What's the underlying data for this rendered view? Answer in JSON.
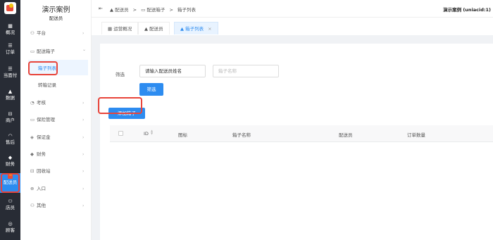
{
  "rail": {
    "items": [
      {
        "label": "概况",
        "icon": "dashboard-icon",
        "glyph": "▦"
      },
      {
        "label": "订单",
        "icon": "orders-icon",
        "glyph": "☰"
      },
      {
        "label": "当面付",
        "icon": "pay-icon",
        "glyph": "☰"
      },
      {
        "label": "数据",
        "icon": "data-icon",
        "glyph": "▲"
      },
      {
        "label": "商户",
        "icon": "merchant-icon",
        "glyph": "⊟"
      },
      {
        "label": "售后",
        "icon": "aftersale-icon",
        "glyph": "◠"
      },
      {
        "label": "财务",
        "icon": "finance-icon",
        "glyph": "◆"
      },
      {
        "label": "配送员",
        "icon": "courier-icon",
        "glyph": ""
      },
      {
        "label": "店员",
        "icon": "staff-icon",
        "glyph": "⚇"
      },
      {
        "label": "顾客",
        "icon": "customer-icon",
        "glyph": "◎"
      }
    ]
  },
  "sidebar": {
    "title": "演示案例",
    "subtitle": "配送员",
    "items": [
      {
        "label": "平台",
        "glyph": "⚇",
        "arrow": "›"
      },
      {
        "label": "配送箱子",
        "glyph": "▭",
        "arrow": "⌄"
      },
      {
        "label": "箱子列表",
        "glyph": "",
        "arrow": ""
      },
      {
        "label": "转箱记录",
        "glyph": "",
        "arrow": ""
      },
      {
        "label": "考核",
        "glyph": "◔",
        "arrow": "›"
      },
      {
        "label": "保险管理",
        "glyph": "▭",
        "arrow": "›"
      },
      {
        "label": "保证金",
        "glyph": "◈",
        "arrow": "›"
      },
      {
        "label": "财务",
        "glyph": "◆",
        "arrow": "›"
      },
      {
        "label": "回收站",
        "glyph": "⊡",
        "arrow": "›"
      },
      {
        "label": "入口",
        "glyph": "⊕",
        "arrow": "›"
      },
      {
        "label": "其他",
        "glyph": "⚇",
        "arrow": "›"
      }
    ]
  },
  "header": {
    "collapse_glyph": "⇤",
    "crumb1": "配送员",
    "sep": ">",
    "crumb2": "配送箱子",
    "crumb3": "箱子列表",
    "user": "演示案例 (uniacid:1)"
  },
  "tabs": [
    {
      "label": "运营概况",
      "glyph": "▦"
    },
    {
      "label": "配送员",
      "glyph": "▲"
    },
    {
      "label": "箱子列表",
      "glyph": "▲",
      "close": "×"
    }
  ],
  "filter": {
    "label": "筛选",
    "courier_input": "请输入配送员姓名",
    "box_placeholder": "箱子名称",
    "button": "筛选"
  },
  "add_button": "添加箱子",
  "table": {
    "headers": {
      "id": "ID",
      "icon": "图标",
      "name": "箱子名称",
      "courier": "配送员",
      "orders": "订单数量"
    }
  },
  "colors": {
    "accent": "#2d8cf0",
    "highlight": "#e8443a",
    "rail": "#282c35"
  }
}
